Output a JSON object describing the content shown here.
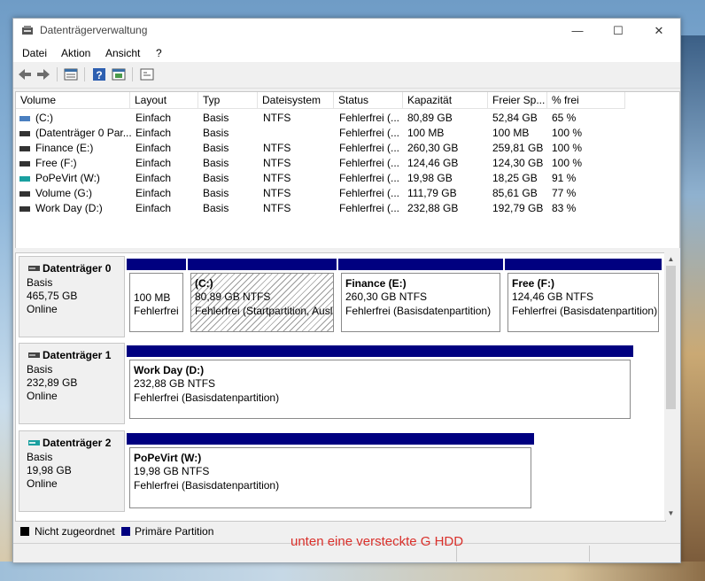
{
  "window": {
    "title": "Datenträgerverwaltung"
  },
  "titlebar_buttons": {
    "minimize": "—",
    "maximize": "☐",
    "close": "✕"
  },
  "menu": [
    "Datei",
    "Aktion",
    "Ansicht",
    "?"
  ],
  "toolbar_icons": [
    "back-arrow-icon",
    "forward-arrow-icon",
    "disk-list-icon",
    "help-icon",
    "properties-icon",
    "console-icon"
  ],
  "table": {
    "columns": [
      "Volume",
      "Layout",
      "Typ",
      "Dateisystem",
      "Status",
      "Kapazität",
      "Freier Sp...",
      "% frei"
    ],
    "rows": [
      [
        "(C:)",
        "Einfach",
        "Basis",
        "NTFS",
        "Fehlerfrei (...",
        "80,89 GB",
        "52,84 GB",
        "65 %"
      ],
      [
        "(Datenträger 0 Par...",
        "Einfach",
        "Basis",
        "",
        "Fehlerfrei (...",
        "100 MB",
        "100 MB",
        "100 %"
      ],
      [
        "Finance (E:)",
        "Einfach",
        "Basis",
        "NTFS",
        "Fehlerfrei (...",
        "260,30 GB",
        "259,81 GB",
        "100 %"
      ],
      [
        "Free (F:)",
        "Einfach",
        "Basis",
        "NTFS",
        "Fehlerfrei (...",
        "124,46 GB",
        "124,30 GB",
        "100 %"
      ],
      [
        "PoPeVirt (W:)",
        "Einfach",
        "Basis",
        "NTFS",
        "Fehlerfrei (...",
        "19,98 GB",
        "18,25 GB",
        "91 %"
      ],
      [
        "Volume (G:)",
        "Einfach",
        "Basis",
        "NTFS",
        "Fehlerfrei (...",
        "111,79 GB",
        "85,61 GB",
        "77 %"
      ],
      [
        "Work Day (D:)",
        "Einfach",
        "Basis",
        "NTFS",
        "Fehlerfrei (...",
        "232,88 GB",
        "192,79 GB",
        "83 %"
      ]
    ],
    "row_icon_colors": [
      "#4a7fc0",
      "#333333",
      "#333333",
      "#333333",
      "#1aa0a0",
      "#333333",
      "#333333"
    ]
  },
  "disks": [
    {
      "name": "Datenträger 0",
      "type": "Basis",
      "size": "465,75 GB",
      "state": "Online",
      "partitions": [
        {
          "name": "",
          "size": "100 MB",
          "status": "Fehlerfrei"
        },
        {
          "name": "(C:)",
          "size": "80,89 GB NTFS",
          "status": "Fehlerfrei (Startpartition, Ausl"
        },
        {
          "name": "Finance  (E:)",
          "size": "260,30 GB NTFS",
          "status": "Fehlerfrei (Basisdatenpartition)"
        },
        {
          "name": "Free  (F:)",
          "size": "124,46 GB NTFS",
          "status": "Fehlerfrei (Basisdatenpartition)"
        }
      ]
    },
    {
      "name": "Datenträger 1",
      "type": "Basis",
      "size": "232,89 GB",
      "state": "Online",
      "partitions": [
        {
          "name": "Work Day  (D:)",
          "size": "232,88 GB NTFS",
          "status": "Fehlerfrei (Basisdatenpartition)"
        }
      ]
    },
    {
      "name": "Datenträger 2",
      "type": "Basis",
      "size": "19,98 GB",
      "state": "Online",
      "partitions": [
        {
          "name": "PoPeVirt  (W:)",
          "size": "19,98 GB NTFS",
          "status": "Fehlerfrei (Basisdatenpartition)"
        }
      ]
    }
  ],
  "legend": {
    "unallocated": "Nicht zugeordnet",
    "primary": "Primäre Partition",
    "colors": {
      "unallocated": "#000000",
      "primary": "#000080"
    }
  },
  "annotation": "unten eine versteckte G HDD",
  "colors": {
    "partition_bar": "#000080",
    "annotation": "#d9302b"
  }
}
